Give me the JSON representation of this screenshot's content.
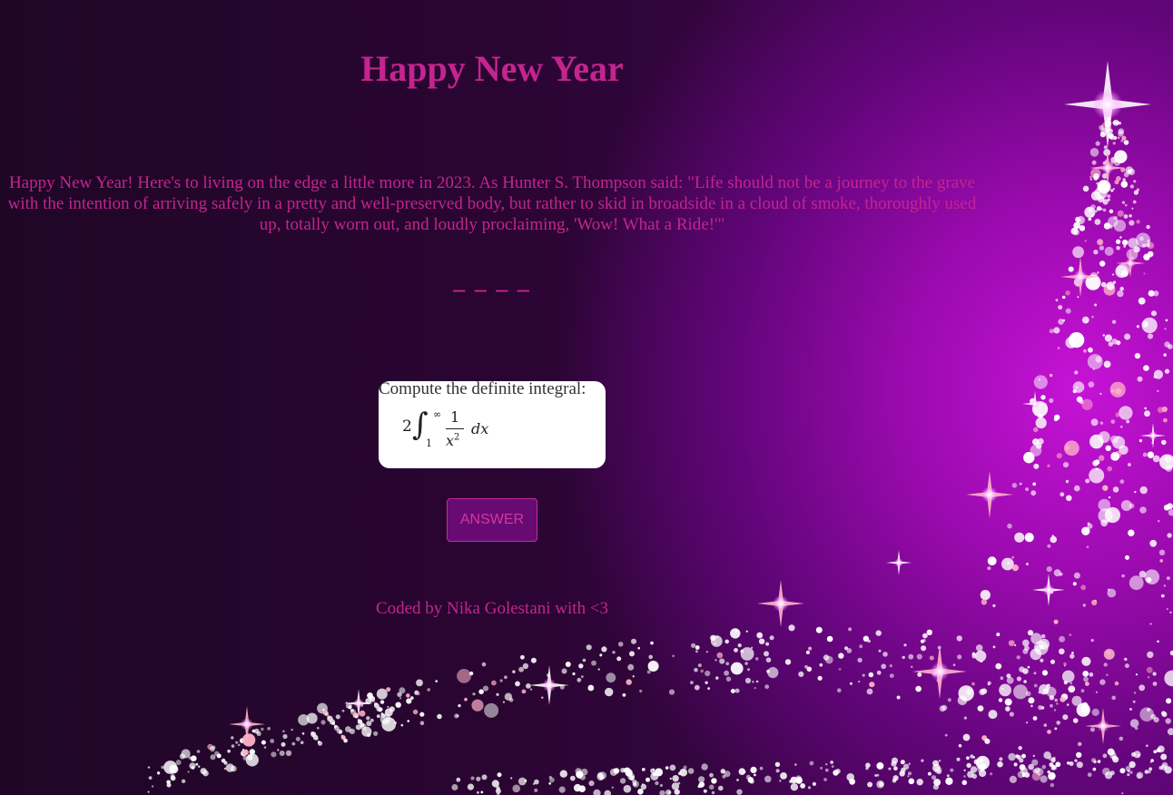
{
  "page": {
    "title": "Happy New Year",
    "message": "Happy New Year! Here's to living on the edge a little more in 2023. As Hunter S. Thompson said: \"Life should not be a journey to the grave with the intention of arriving safely in a pretty and well-preserved body, but rather to skid in broadside in a cloud of smoke, thoroughly used up, totally worn out, and loudly proclaiming, 'Wow! What a Ride!'\"",
    "divider": "_ _ _ _"
  },
  "question": {
    "prompt": "Compute the definite integral:",
    "formula": {
      "coefficient": "2",
      "integral_sign": "∫",
      "upper_limit": "∞",
      "lower_limit": "1",
      "numerator": "1",
      "denominator_base": "x",
      "denominator_exponent": "2",
      "differential": "dx"
    }
  },
  "answer_button": {
    "label": "ANSWER"
  },
  "footer": {
    "credit": "Coded by Nika Golestani with <3"
  },
  "colors": {
    "accent_text": "#c3258e",
    "button_background": "#670b73",
    "card_background": "#ffffff"
  },
  "background": {
    "image": "sparkling-christmas-tree"
  }
}
